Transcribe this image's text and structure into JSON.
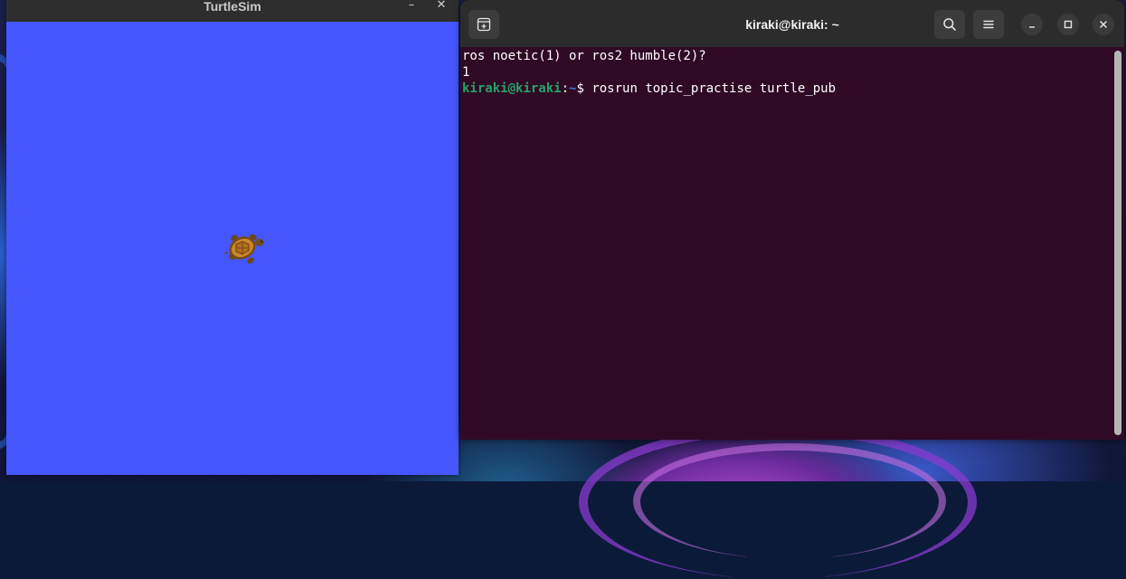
{
  "turtlesim": {
    "title": "TurtleSim",
    "minimize_glyph": "–",
    "close_glyph": "✕",
    "background_color": "#4556ff"
  },
  "terminal": {
    "title": "kiraki@kiraki: ~",
    "lines": [
      "ros noetic(1) or ros2 humble(2)?",
      "1"
    ],
    "prompt": {
      "user_host": "kiraki@kiraki",
      "sep": ":",
      "path": "~",
      "symbol": "$ ",
      "command": "rosrun topic_practise turtle_pub"
    },
    "icons": {
      "new_tab": "new-tab-icon",
      "search": "search-icon",
      "menu": "hamburger-menu-icon",
      "minimize": "minimize-icon",
      "maximize": "maximize-icon",
      "close": "close-icon"
    },
    "colors": {
      "background": "#300a24",
      "prompt_user": "#26a269",
      "prompt_path": "#3b78d8"
    }
  }
}
